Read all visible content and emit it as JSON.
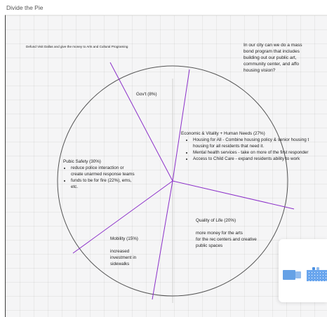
{
  "frame": {
    "title": "Divide the Pie"
  },
  "top_note": "Defund Visit Dallas and give the money to Arts and Cultural Programing",
  "bond_question": "In our city can we do a mass\nbond program that includes\nbuilding out our public art,\ncommunity center, and affo\nhousing vision?",
  "pie": {
    "stroke_color": "#555555",
    "divider_color": "#8b2fc9",
    "axis_color": "#c8c8c8",
    "slices": [
      {
        "id": "govt",
        "title": "Gov't (8%)",
        "percent": 8,
        "bullets": [],
        "body": ""
      },
      {
        "id": "economic",
        "title": "Economic & Vitality + Human Needs (27%)",
        "percent": 27,
        "bullets": [
          "Housing for All - Combine housing policy & senior housing t",
          "housing for all residents that need it.",
          "Mental health services - take on more of the first responder",
          "Access to Child Care - expand residents ability to work"
        ],
        "body": ""
      },
      {
        "id": "quality",
        "title": "Quality of Life (20%)",
        "percent": 20,
        "bullets": [],
        "body": "more money for the arts\nfor the rec centers and creative\npublic spaces"
      },
      {
        "id": "mobility",
        "title": "Mobility (15%)",
        "percent": 15,
        "bullets": [],
        "body": "increased\ninvestment in\nsidewalks"
      },
      {
        "id": "safety",
        "title": "Pubic Safety (30%)",
        "percent": 30,
        "bullets": [
          "reduce police interaction or",
          "create unarmed response teams",
          "funds to be for fire (22%), ems,",
          "etc."
        ],
        "body": ""
      }
    ]
  },
  "widget": {
    "accent": "#4a90e2"
  }
}
